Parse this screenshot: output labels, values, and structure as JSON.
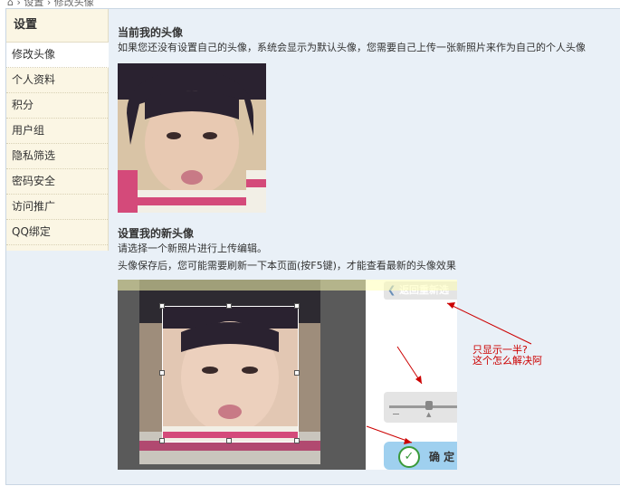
{
  "breadcrumb": {
    "item1": "设置",
    "item2": "修改头像"
  },
  "sidebar": {
    "title": "设置",
    "items": [
      {
        "label": "修改头像",
        "active": true
      },
      {
        "label": "个人资料"
      },
      {
        "label": "积分"
      },
      {
        "label": "用户组"
      },
      {
        "label": "隐私筛选"
      },
      {
        "label": "密码安全"
      },
      {
        "label": "访问推广"
      },
      {
        "label": "QQ绑定"
      }
    ]
  },
  "current_avatar": {
    "heading": "当前我的头像",
    "description": "如果您还没有设置自己的头像，系统会显示为默认头像，您需要自己上传一张新照片来作为自己的个人头像"
  },
  "new_avatar": {
    "heading": "设置我的新头像",
    "line1": "请选择一个新照片进行上传编辑。",
    "line2": "头像保存后，您可能需要刷新一下本页面(按F5键)，才能查看最新的头像效果"
  },
  "editor": {
    "back_label": "返回重新选",
    "confirm_label": "确 定"
  },
  "annotation": {
    "line1": "只显示一半?",
    "line2": "这个怎么解决阿"
  },
  "colors": {
    "accent_red": "#cc0000",
    "sidebar_bg": "#fbf6e4",
    "content_bg": "#e9f0f7",
    "confirm_bg": "#9fd0ef"
  }
}
